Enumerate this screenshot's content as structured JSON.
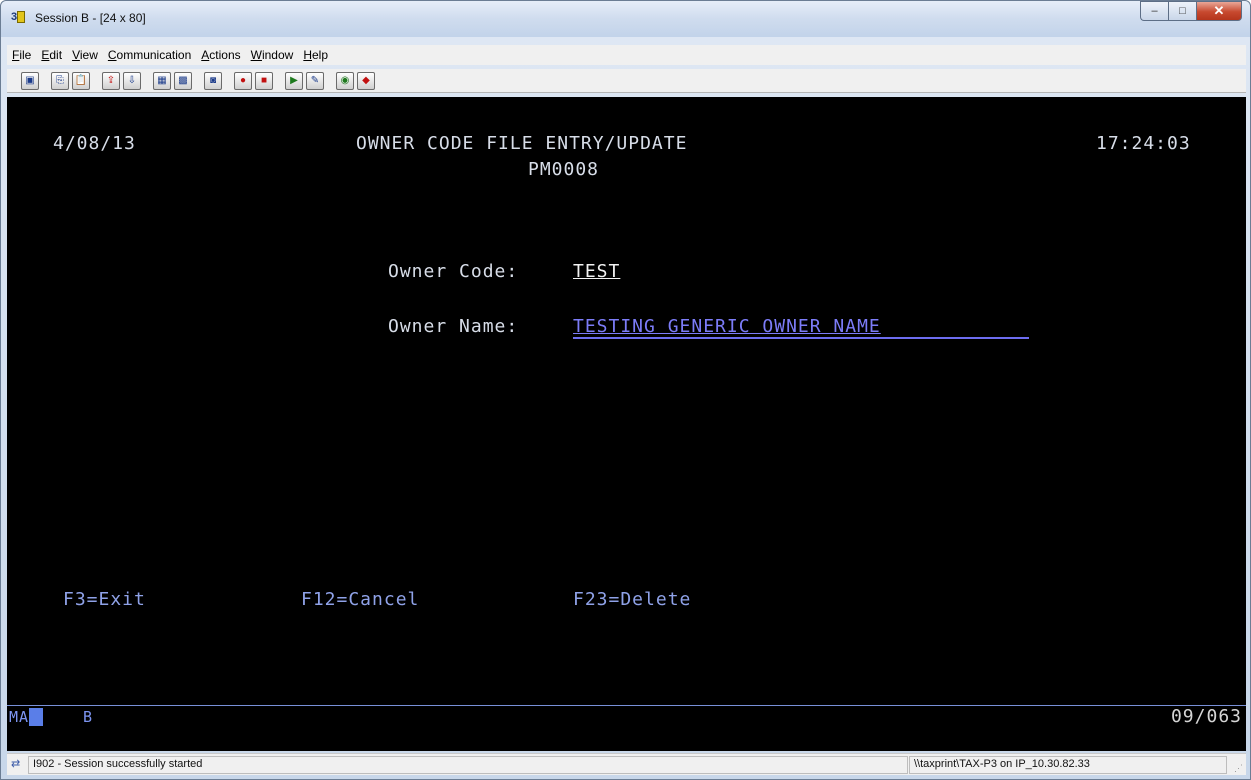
{
  "window": {
    "title": "Session B - [24 x 80]",
    "controls": {
      "minimize": "–",
      "maximize": "□",
      "close": "✕"
    }
  },
  "menubar": {
    "items": [
      {
        "label": "File",
        "mnemonic": "F",
        "rest": "ile"
      },
      {
        "label": "Edit",
        "mnemonic": "E",
        "rest": "dit"
      },
      {
        "label": "View",
        "mnemonic": "V",
        "rest": "iew"
      },
      {
        "label": "Communication",
        "mnemonic": "C",
        "rest": "ommunication"
      },
      {
        "label": "Actions",
        "mnemonic": "A",
        "rest": "ctions"
      },
      {
        "label": "Window",
        "mnemonic": "W",
        "rest": "indow"
      },
      {
        "label": "Help",
        "mnemonic": "H",
        "rest": "elp"
      }
    ]
  },
  "toolbar": {
    "icons": [
      {
        "name": "print-screen-icon",
        "glyph": "▣"
      },
      {
        "name": "copy-icon",
        "glyph": "⎘"
      },
      {
        "name": "paste-icon",
        "glyph": "📋"
      },
      {
        "name": "send-file-icon",
        "glyph": "⇪"
      },
      {
        "name": "receive-file-icon",
        "glyph": "⇩"
      },
      {
        "name": "display-icon",
        "glyph": "▦"
      },
      {
        "name": "keypad-icon",
        "glyph": "▩"
      },
      {
        "name": "macro-icon",
        "glyph": "◙"
      },
      {
        "name": "record-macro-icon",
        "glyph": "●"
      },
      {
        "name": "stop-macro-icon",
        "glyph": "■"
      },
      {
        "name": "play-macro-icon",
        "glyph": "▶"
      },
      {
        "name": "edit-macro-icon",
        "glyph": "✎"
      },
      {
        "name": "globe-icon",
        "glyph": "◉"
      },
      {
        "name": "help-icon",
        "glyph": "◆"
      }
    ]
  },
  "screen": {
    "date": "4/08/13",
    "title": "OWNER CODE FILE ENTRY/UPDATE",
    "program": "PM0008",
    "time": "17:24:03",
    "owner_code_label": "Owner Code:",
    "owner_code_value": "TEST",
    "owner_name_label": "Owner Name:",
    "owner_name_value": "TESTING GENERIC OWNER NAME",
    "fkeys": {
      "f3": "F3=Exit",
      "f12": "F12=Cancel",
      "f23": "F23=Delete"
    },
    "oia": {
      "mode": "MA",
      "session": "B",
      "cursor_position": "09/063"
    }
  },
  "statusbar": {
    "message": "I902 - Session successfully started",
    "connection": "\\\\taxprint\\TAX-P3 on IP_10.30.82.33"
  }
}
